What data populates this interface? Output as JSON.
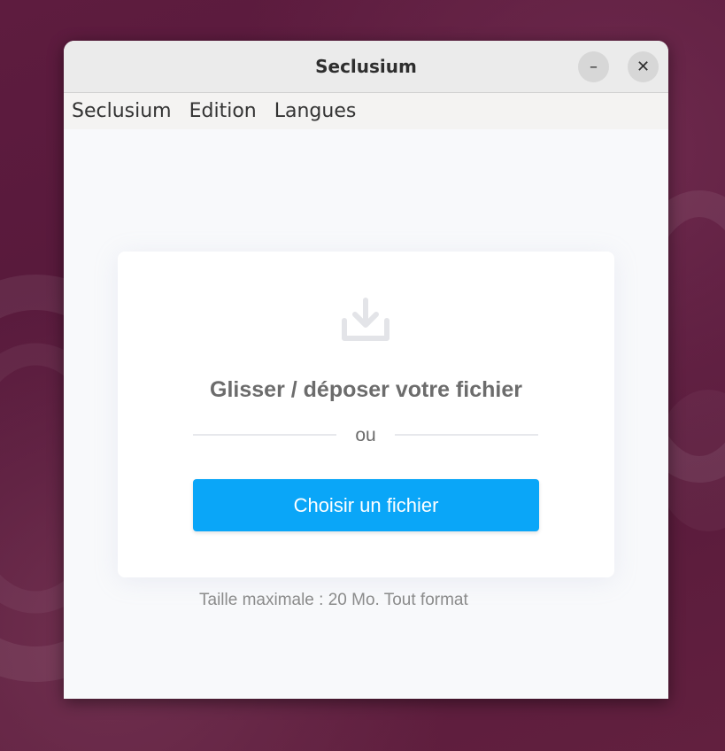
{
  "window": {
    "title": "Seclusium",
    "minimize_glyph": "–",
    "close_glyph": "✕"
  },
  "menubar": {
    "items": [
      {
        "label": "Seclusium"
      },
      {
        "label": "Edition"
      },
      {
        "label": "Langues"
      }
    ]
  },
  "upload": {
    "icon": "download-icon",
    "drop_text": "Glisser / déposer votre fichier",
    "or_text": "ou",
    "choose_button": "Choisir un fichier",
    "max_size_text": "Taille maximale : 20 Mo. Tout format"
  },
  "colors": {
    "accent": "#0aa6f8",
    "desktop": "#5a1b3c"
  }
}
